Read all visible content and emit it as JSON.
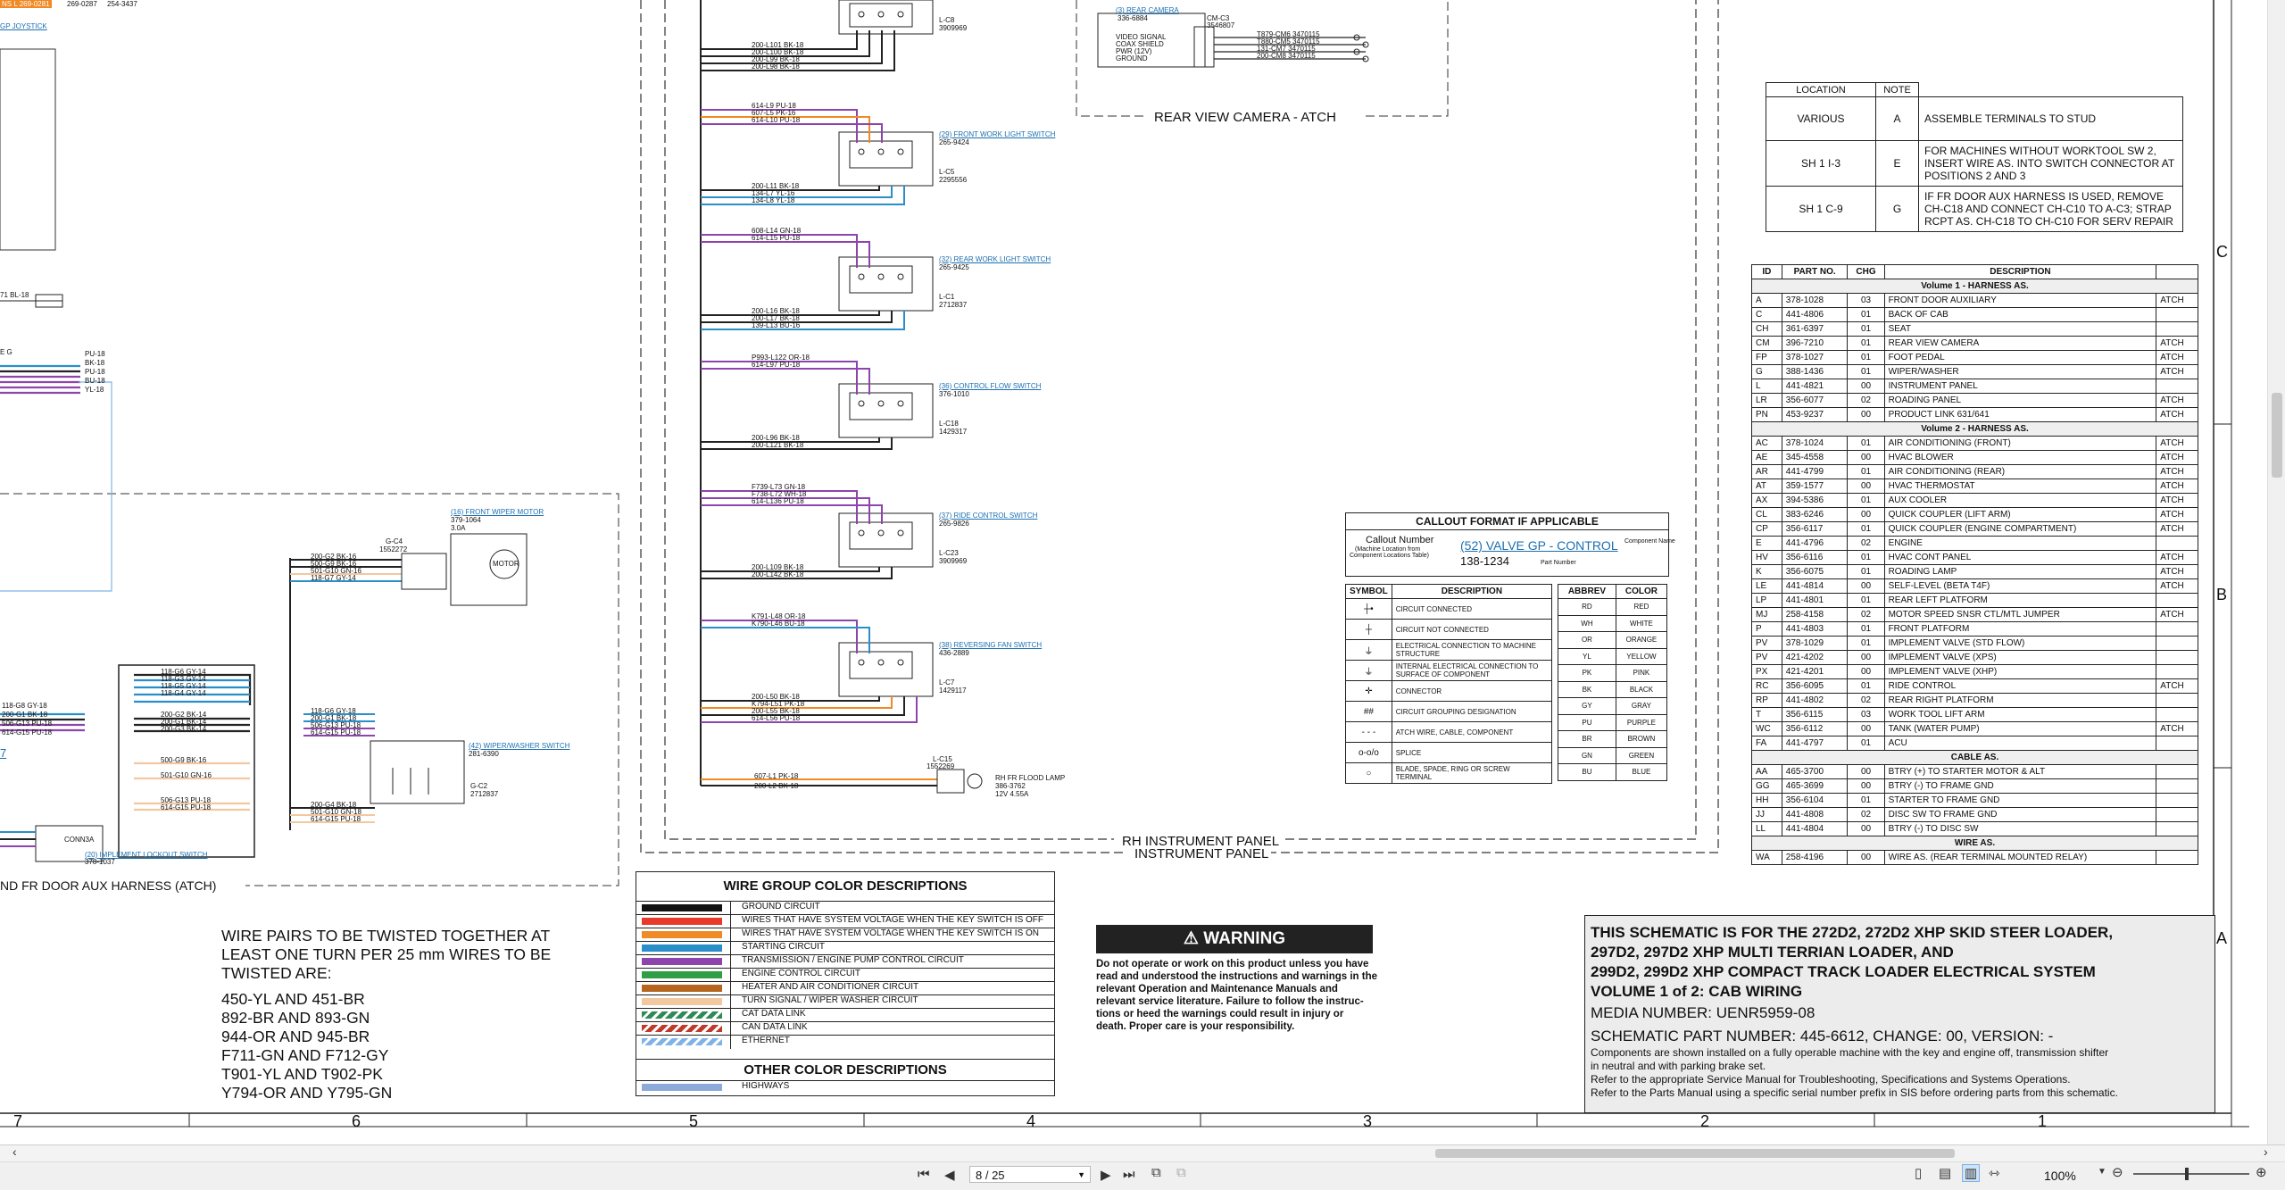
{
  "header_fragment": {
    "label_a": "NS L 269-0281",
    "label_b": "269-0287",
    "label_c": "254-3437",
    "link": "GP JOYSTICK"
  },
  "left_fragment": {
    "wire_a": "71 BL-18",
    "e_label": "E G",
    "wires": [
      "PU-18",
      "BK-18",
      "PU-18",
      "BU-18",
      "YL-18"
    ],
    "lower_wires": [
      "118-G8 GY-18",
      "200-G1 BK-18",
      "506-G13 PU-18",
      "614-G15 PU-18"
    ],
    "num_link": "7",
    "harness_label": "ND FR DOOR AUX HARNESS (ATCH)",
    "lockout": "(20) IMPLEMENT LOCKOUT SWITCH",
    "lockout_pn": "378-1037",
    "conn_label": "CONN3A"
  },
  "twisted_pairs": {
    "title_lines": [
      "WIRE PAIRS TO BE TWISTED TOGETHER AT",
      "LEAST ONE TURN PER 25 mm WIRES TO BE",
      "TWISTED ARE:"
    ],
    "pairs": [
      "450-YL AND 451-BR",
      "892-BR AND 893-GN",
      "944-OR AND 945-BR",
      "F711-GN AND F712-GY",
      "T901-YL AND T902-PK",
      "Y794-OR AND Y795-GN"
    ]
  },
  "mid_components": {
    "wiper_motor": {
      "link": "(16) FRONT WIPER MOTOR",
      "pn": "379-1064",
      "rating": "3.0A",
      "conn": "G-C4",
      "conn_pn": "1552272",
      "motor": "MOTOR",
      "wires": [
        "200-G2 BK-16",
        "500-G9 BK-16",
        "501-G10 GN-16",
        "118-G7 GY-14"
      ]
    },
    "washer_switch": {
      "link": "(42) WIPER/WASHER SWITCH",
      "pn": "281-6390",
      "conn": "G-C2",
      "conn_pn": "2712837",
      "wires_in": [
        "118-G6 GY-14",
        "118-G3 GY-14",
        "118-G5 GY-14",
        "118-G4 GY-14"
      ],
      "wires_bk": [
        "200-G2 BK-14",
        "200-G1 BK-14",
        "200-G3 BK-14"
      ],
      "wires_c": [
        "118-G6 GY-18",
        "200-G1 BK-18",
        "506-G13 PU-18",
        "614-G15 PU-18"
      ],
      "wires_d": [
        "500-G9 BK-16",
        "501-G10 GN-16",
        "506-G13 PU-18",
        "614-G15 PU-18"
      ],
      "wires_e": [
        "200-G4 BK-18",
        "501-G10 GN-18",
        "614-G15 PU-18"
      ]
    }
  },
  "switches": [
    {
      "link": "",
      "conn": "L-C8",
      "pn": "3909969",
      "wires": [
        "200-L101 BK-18",
        "200-L100 BK-18",
        "200-L99 BK-18",
        "200-L98 BK-18"
      ]
    },
    {
      "link": "(29) FRONT WORK LIGHT SWITCH",
      "pn_sw": "265-9424",
      "conn": "L-C5",
      "pn": "2295556",
      "wires": [
        "614-L9 PU-18",
        "607-L5 PK-16",
        "614-L10 PU-18"
      ],
      "wires2": [
        "200-L11 BK-18",
        "134-L7 YL-16",
        "134-L8 YL-18"
      ]
    },
    {
      "link": "(32) REAR WORK LIGHT SWITCH",
      "pn_sw": "265-9425",
      "conn": "L-C1",
      "pn": "2712837",
      "wires": [
        "608-L14 GN-18",
        "614-L15 PU-18"
      ],
      "wires2": [
        "200-L16 BK-18",
        "200-L17 BK-18",
        "139-L13 BU-16"
      ]
    },
    {
      "link": "(36) CONTROL FLOW SWITCH",
      "pn_sw": "376-1010",
      "conn": "L-C18",
      "pn": "1429317",
      "wires": [
        "P993-L122 OR-18",
        "614-L97 PU-18"
      ],
      "wires2": [
        "200-L96 BK-18",
        "200-L121 BK-18"
      ]
    },
    {
      "link": "(37) RIDE CONTROL SWITCH",
      "pn_sw": "265-9826",
      "conn": "L-C23",
      "pn": "3909969",
      "wires": [
        "F739-L73 GN-18",
        "F738-L72 WH-18",
        "614-L136 PU-18"
      ],
      "wires2": [
        "200-L109 BK-18",
        "200-L142 BK-18"
      ]
    },
    {
      "link": "(38) REVERSING FAN SWITCH",
      "pn_sw": "436-2889",
      "conn": "L-C7",
      "pn": "1429117",
      "wires": [
        "K791-L48 OR-18",
        "K790-L46 BU-18"
      ],
      "wires2": [
        "200-L50 BK-18",
        "K794-L51 PK-18",
        "200-L55 BK-18",
        "614-L56 PU-18"
      ]
    }
  ],
  "flood_lamp": {
    "conn": "L-C15",
    "conn_pn": "1552269",
    "label": "RH FR FLOOD LAMP",
    "pn": "386-3762",
    "rating": "12V 4.55A",
    "wires": [
      "607-L1 PK-18",
      "200-L2 BK-18"
    ]
  },
  "camera": {
    "link": "(3) REAR CAMERA",
    "pn": "336-6884",
    "conn": "CM-C3",
    "conn_pn": "3546807",
    "signals": [
      "VIDEO SIGNAL",
      "COAX SHIELD",
      "PWR (12V)",
      "GROUND"
    ],
    "wires": [
      "T879-CM6 3470115",
      "T880-CM5 3470115",
      "131-CM7 3470115",
      "200-CM8 3470115"
    ],
    "harness": "REAR VIEW CAMERA - ATCH"
  },
  "panel_labels": {
    "rh": "RH INSTRUMENT PANEL",
    "inst": "INSTRUMENT PANEL"
  },
  "wire_group": {
    "title": "WIRE GROUP COLOR DESCRIPTIONS",
    "rows": [
      {
        "label": "GROUND CIRCUIT",
        "color": "#111111"
      },
      {
        "label": "WIRES THAT HAVE SYSTEM VOLTAGE WHEN THE KEY SWITCH IS OFF",
        "color": "#e8392a"
      },
      {
        "label": "WIRES THAT HAVE SYSTEM VOLTAGE WHEN THE KEY SWITCH IS ON",
        "color": "#f08a24"
      },
      {
        "label": "STARTING CIRCUIT",
        "color": "#2a8ec8"
      },
      {
        "label": "TRANSMISSION / ENGINE PUMP CONTROL CIRCUIT",
        "color": "#8e44ad"
      },
      {
        "label": "ENGINE CONTROL CIRCUIT",
        "color": "#2f9e44"
      },
      {
        "label": "HEATER AND AIR CONDITIONER CIRCUIT",
        "color": "#b5651d"
      },
      {
        "label": "TURN SIGNAL / WIPER WASHER CIRCUIT",
        "color": "#f2c8a0"
      },
      {
        "label": "CAT DATA LINK",
        "color": "#2e8b57"
      },
      {
        "label": "CAN DATA LINK",
        "color": "#c0392b"
      },
      {
        "label": "ETHERNET",
        "color": "#7fb3e6"
      }
    ],
    "other_title": "OTHER COLOR DESCRIPTIONS",
    "other_rows": [
      {
        "label": "HIGHWAYS",
        "color": "#8eaadb"
      }
    ]
  },
  "warning": {
    "title": "WARNING",
    "lines": [
      "Do not operate or work on this product unless you have",
      "read and understood the instructions and warnings in the",
      "relevant Operation and Maintenance Manuals and",
      "relevant service literature. Failure to follow the instruc-",
      "tions or heed the warnings could result in injury or",
      "death. Proper care is your responsibility."
    ]
  },
  "callout": {
    "title": "CALLOUT FORMAT IF APPLICABLE",
    "callout_number": "Callout Number",
    "loc_note": "(Machine Location from",
    "loc_note2": "Component Locations Table)",
    "example_link": "(52) VALVE GP - CONTROL",
    "example_pn": "138-1234",
    "component_name": "Component Name",
    "part_number": "Part Number"
  },
  "symbols": {
    "headers": [
      "SYMBOL",
      "DESCRIPTION"
    ],
    "rows": [
      {
        "sym": "┼•",
        "desc": "CIRCUIT CONNECTED"
      },
      {
        "sym": "┼",
        "desc": "CIRCUIT NOT CONNECTED"
      },
      {
        "sym": "⏚",
        "desc": "ELECTRICAL CONNECTION TO MACHINE STRUCTURE"
      },
      {
        "sym": "⏚",
        "desc": "INTERNAL ELECTRICAL CONNECTION TO SURFACE OF COMPONENT"
      },
      {
        "sym": "✛",
        "desc": "CONNECTOR"
      },
      {
        "sym": "##",
        "desc": "CIRCUIT GROUPING DESIGNATION"
      },
      {
        "sym": "- - -",
        "desc": "ATCH WIRE, CABLE, COMPONENT"
      },
      {
        "sym": "o-o/o",
        "desc": "SPLICE"
      },
      {
        "sym": "○",
        "desc": "BLADE, SPADE, RING OR SCREW TERMINAL"
      }
    ]
  },
  "abbrev": {
    "headers": [
      "ABBREV",
      "COLOR"
    ],
    "rows": [
      [
        "RD",
        "RED"
      ],
      [
        "WH",
        "WHITE"
      ],
      [
        "OR",
        "ORANGE"
      ],
      [
        "YL",
        "YELLOW"
      ],
      [
        "PK",
        "PINK"
      ],
      [
        "BK",
        "BLACK"
      ],
      [
        "GY",
        "GRAY"
      ],
      [
        "PU",
        "PURPLE"
      ],
      [
        "BR",
        "BROWN"
      ],
      [
        "GN",
        "GREEN"
      ],
      [
        "BU",
        "BLUE"
      ]
    ]
  },
  "location_notes": {
    "headers": [
      "LOCATION",
      "NOTE"
    ],
    "rows": [
      {
        "loc": "VARIOUS",
        "note": "A",
        "text": "ASSEMBLE TERMINALS TO STUD"
      },
      {
        "loc": "SH 1 I-3",
        "note": "E",
        "text": "FOR MACHINES WITHOUT WORKTOOL SW 2, INSERT WIRE AS. INTO SWITCH CONNECTOR AT POSITIONS 2 AND 3"
      },
      {
        "loc": "SH 1 C-9",
        "note": "G",
        "text": "IF FR DOOR AUX HARNESS IS USED, REMOVE CH-C18 AND CONNECT CH-C10 TO A-C3; STRAP RCPT AS. CH-C18 TO CH-C10 FOR SERV REPAIR"
      }
    ]
  },
  "parts": {
    "headers": [
      "ID",
      "PART NO.",
      "CHG",
      "DESCRIPTION"
    ],
    "sections": [
      {
        "title": "Volume 1 - HARNESS AS.",
        "rows": [
          [
            "A",
            "378-1028",
            "03",
            "FRONT DOOR AUXILIARY",
            "ATCH"
          ],
          [
            "C",
            "441-4806",
            "01",
            "BACK OF CAB",
            ""
          ],
          [
            "CH",
            "361-6397",
            "01",
            "SEAT",
            ""
          ],
          [
            "CM",
            "396-7210",
            "01",
            "REAR VIEW CAMERA",
            "ATCH"
          ],
          [
            "FP",
            "378-1027",
            "01",
            "FOOT PEDAL",
            "ATCH"
          ],
          [
            "G",
            "388-1436",
            "01",
            "WIPER/WASHER",
            "ATCH"
          ],
          [
            "L",
            "441-4821",
            "00",
            "INSTRUMENT PANEL",
            ""
          ],
          [
            "LR",
            "356-6077",
            "02",
            "ROADING PANEL",
            "ATCH"
          ],
          [
            "PN",
            "453-9237",
            "00",
            "PRODUCT LINK 631/641",
            "ATCH"
          ]
        ]
      },
      {
        "title": "Volume 2 - HARNESS AS.",
        "rows": [
          [
            "AC",
            "378-1024",
            "01",
            "AIR CONDITIONING (FRONT)",
            "ATCH"
          ],
          [
            "AE",
            "345-4558",
            "00",
            "HVAC BLOWER",
            "ATCH"
          ],
          [
            "AR",
            "441-4799",
            "01",
            "AIR CONDITIONING (REAR)",
            "ATCH"
          ],
          [
            "AT",
            "359-1577",
            "00",
            "HVAC THERMOSTAT",
            "ATCH"
          ],
          [
            "AX",
            "394-5386",
            "01",
            "AUX COOLER",
            "ATCH"
          ],
          [
            "CL",
            "383-6246",
            "00",
            "QUICK COUPLER (LIFT ARM)",
            "ATCH"
          ],
          [
            "CP",
            "356-6117",
            "01",
            "QUICK COUPLER (ENGINE COMPARTMENT)",
            "ATCH"
          ],
          [
            "E",
            "441-4796",
            "02",
            "ENGINE",
            ""
          ],
          [
            "HV",
            "356-6116",
            "01",
            "HVAC CONT PANEL",
            "ATCH"
          ],
          [
            "K",
            "356-6075",
            "01",
            "ROADING LAMP",
            "ATCH"
          ],
          [
            "LE",
            "441-4814",
            "00",
            "SELF-LEVEL (BETA T4F)",
            "ATCH"
          ],
          [
            "LP",
            "441-4801",
            "01",
            "REAR LEFT PLATFORM",
            ""
          ],
          [
            "MJ",
            "258-4158",
            "02",
            "MOTOR SPEED SNSR CTL/MTL JUMPER",
            "ATCH"
          ],
          [
            "P",
            "441-4803",
            "01",
            "FRONT PLATFORM",
            ""
          ],
          [
            "PV",
            "378-1029",
            "01",
            "IMPLEMENT VALVE (STD FLOW)",
            ""
          ],
          [
            "PV",
            "421-4202",
            "00",
            "IMPLEMENT VALVE (XPS)",
            ""
          ],
          [
            "PX",
            "421-4201",
            "00",
            "IMPLEMENT VALVE (XHP)",
            ""
          ],
          [
            "RC",
            "356-6095",
            "01",
            "RIDE CONTROL",
            "ATCH"
          ],
          [
            "RP",
            "441-4802",
            "02",
            "REAR RIGHT PLATFORM",
            ""
          ],
          [
            "T",
            "356-6115",
            "03",
            "WORK TOOL LIFT ARM",
            ""
          ],
          [
            "WC",
            "356-6112",
            "00",
            "TANK (WATER PUMP)",
            "ATCH"
          ],
          [
            "FA",
            "441-4797",
            "01",
            "ACU",
            ""
          ]
        ]
      },
      {
        "title": "CABLE AS.",
        "rows": [
          [
            "AA",
            "465-3700",
            "00",
            "BTRY (+) TO STARTER MOTOR & ALT",
            ""
          ],
          [
            "GG",
            "465-3699",
            "00",
            "BTRY (-) TO FRAME GND",
            ""
          ],
          [
            "HH",
            "356-6104",
            "01",
            "STARTER TO FRAME GND",
            ""
          ],
          [
            "JJ",
            "441-4808",
            "02",
            "DISC SW TO FRAME GND",
            ""
          ],
          [
            "LL",
            "441-4804",
            "00",
            "BTRY (-) TO DISC SW",
            ""
          ]
        ]
      },
      {
        "title": "WIRE AS.",
        "rows": [
          [
            "WA",
            "258-4196",
            "00",
            "WIRE AS. (REAR TERMINAL MOUNTED RELAY)",
            ""
          ]
        ]
      }
    ]
  },
  "title_block": {
    "lines": [
      "THIS SCHEMATIC IS FOR THE 272D2, 272D2 XHP SKID STEER LOADER,",
      "297D2, 297D2 XHP MULTI TERRIAN LOADER, AND",
      "299D2, 299D2 XHP COMPACT TRACK LOADER ELECTRICAL SYSTEM",
      "VOLUME 1 of 2: CAB WIRING"
    ],
    "media": "MEDIA NUMBER: UENR5959-08",
    "schematic": "SCHEMATIC PART NUMBER: 445-6612, CHANGE: 00, VERSION: -",
    "notes": [
      "Components are shown installed on a fully operable machine with the key and engine off, transmission shifter",
      "in neutral and with parking brake set.",
      "Refer to the appropriate Service Manual for Troubleshooting, Specifications and Systems Operations.",
      "Refer to the Parts Manual using a specific serial number prefix in SIS before ordering parts from this schematic."
    ]
  },
  "grid": {
    "cols": [
      "7",
      "6",
      "5",
      "4",
      "3",
      "2",
      "1"
    ],
    "rows": [
      "C",
      "B",
      "A"
    ]
  },
  "viewer": {
    "page_value": "8 / 25",
    "zoom": "100%",
    "hscroll_left": "‹",
    "hscroll_right": "›"
  }
}
